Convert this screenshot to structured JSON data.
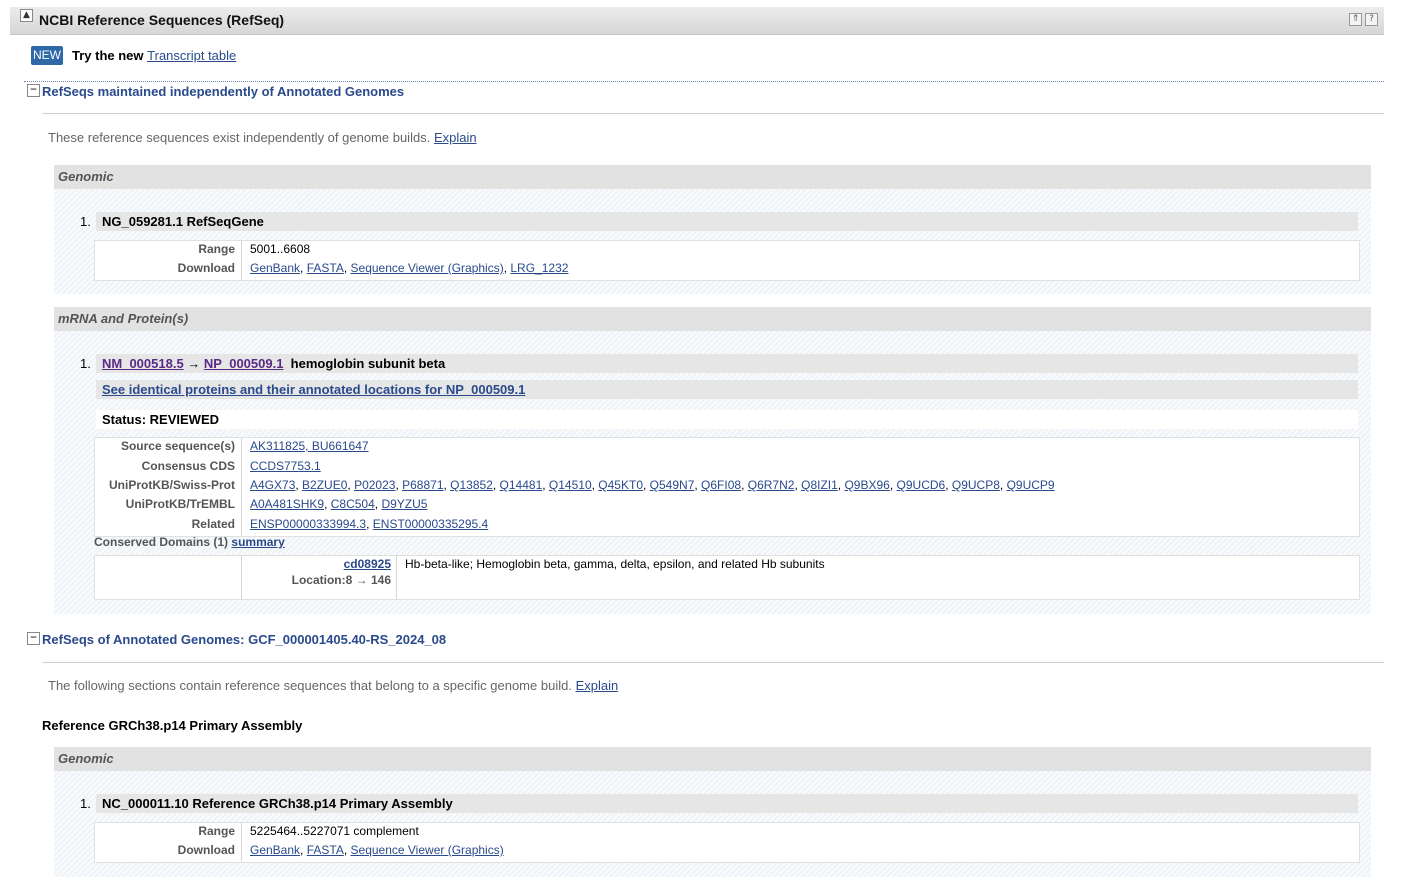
{
  "header": {
    "title": "NCBI Reference Sequences (RefSeq)",
    "toggle_glyph": "▲",
    "btn_top_glyph": "⇑",
    "btn_help_glyph": "?"
  },
  "promo": {
    "badge": "NEW",
    "text": "Try the new",
    "link": "Transcript table"
  },
  "section1": {
    "toggle_glyph": "−",
    "title": "RefSeqs maintained independently of Annotated Genomes",
    "explain_text": "These reference sequences exist independently of genome builds.",
    "explain_link": "Explain",
    "genomic": {
      "heading": "Genomic",
      "num": "1.",
      "title": "NG_059281.1 RefSeqGene",
      "range_key": "Range",
      "range_val": "5001..6608",
      "download_key": "Download",
      "downloads": [
        "GenBank",
        "FASTA",
        "Sequence Viewer (Graphics)",
        "LRG_1232"
      ]
    },
    "mrna": {
      "heading": "mRNA and Protein(s)",
      "num": "1.",
      "nm": "NM_000518.5",
      "arrow": "→",
      "np": "NP_000509.1",
      "gene_desc": "hemoglobin subunit beta",
      "identical_link": "See identical proteins and their annotated locations for NP_000509.1",
      "status": "Status: REVIEWED",
      "rows": [
        {
          "key": "Source sequence(s)",
          "links": [
            "AK311825, BU661647"
          ]
        },
        {
          "key": "Consensus CDS",
          "links": [
            "CCDS7753.1"
          ]
        },
        {
          "key": "UniProtKB/Swiss-Prot",
          "links": [
            "A4GX73",
            "B2ZUE0",
            "P02023",
            "P68871",
            "Q13852",
            "Q14481",
            "Q14510",
            "Q45KT0",
            "Q549N7",
            "Q6FI08",
            "Q6R7N2",
            "Q8IZI1",
            "Q9BX96",
            "Q9UCD6",
            "Q9UCP8",
            "Q9UCP9"
          ]
        },
        {
          "key": "UniProtKB/TrEMBL",
          "links": [
            "A0A481SHK9",
            "C8C504",
            "D9YZU5"
          ]
        },
        {
          "key": "Related",
          "links": [
            "ENSP00000333994.3",
            "ENST00000335295.4"
          ]
        }
      ],
      "conserved_label": "Conserved Domains (1)",
      "conserved_link": "summary",
      "domain_id": "cd08925",
      "domain_location": "Location:8 → 146",
      "domain_desc": "Hb-beta-like; Hemoglobin beta, gamma, delta, epsilon, and related Hb subunits"
    }
  },
  "section2": {
    "toggle_glyph": "−",
    "title": "RefSeqs of Annotated Genomes: GCF_000001405.40-RS_2024_08",
    "explain_text": "The following sections contain reference sequences that belong to a specific genome build.",
    "explain_link": "Explain",
    "assembly_title": "Reference GRCh38.p14 Primary Assembly",
    "genomic": {
      "heading": "Genomic",
      "num": "1.",
      "title": "NC_000011.10 Reference GRCh38.p14 Primary Assembly",
      "range_key": "Range",
      "range_val": "5225464..5227071 complement",
      "download_key": "Download",
      "downloads": [
        "GenBank",
        "FASTA",
        "Sequence Viewer (Graphics)"
      ]
    }
  }
}
